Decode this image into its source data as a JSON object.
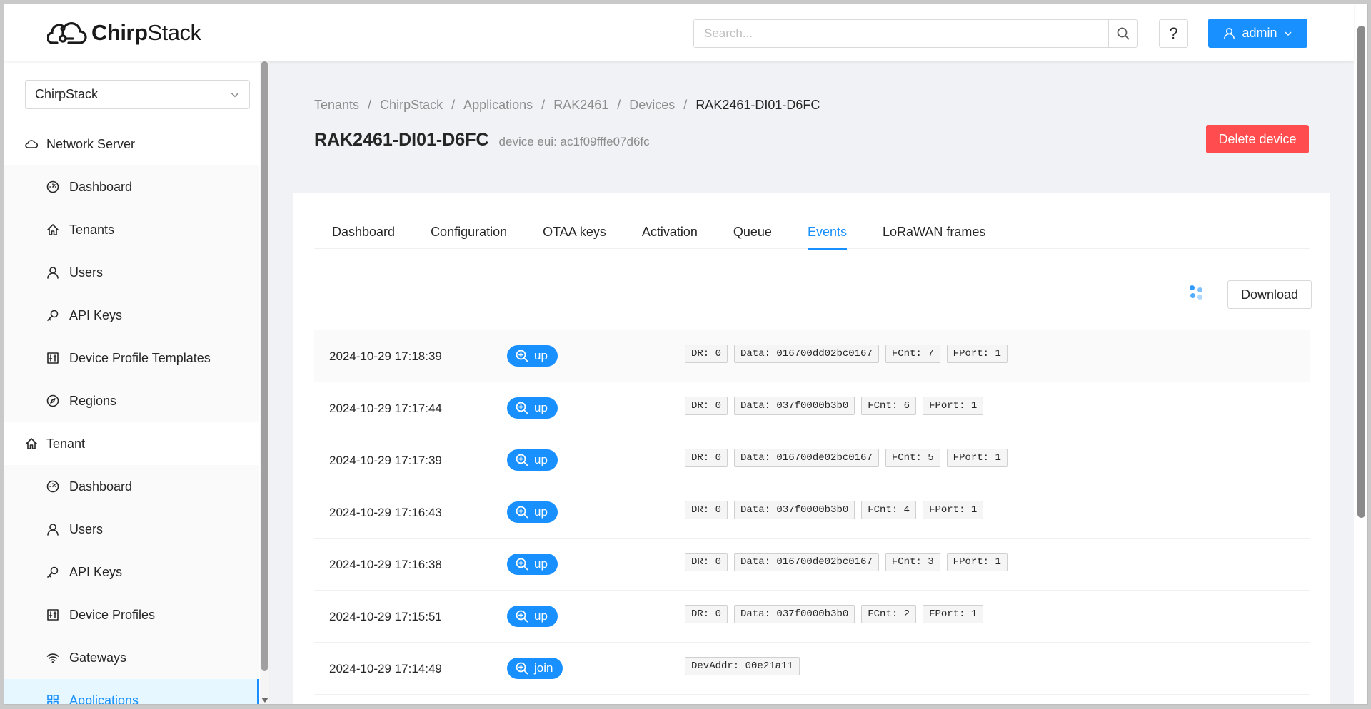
{
  "header": {
    "logo_text_bold": "Chirp",
    "logo_text_light": "Stack",
    "search_placeholder": "Search...",
    "help_label": "?",
    "user_label": "admin"
  },
  "sidebar": {
    "tenant_select": "ChirpStack",
    "network_server": {
      "label": "Network Server",
      "items": [
        {
          "label": "Dashboard",
          "icon": "dashboard-icon"
        },
        {
          "label": "Tenants",
          "icon": "home-icon"
        },
        {
          "label": "Users",
          "icon": "user-icon"
        },
        {
          "label": "API Keys",
          "icon": "key-icon"
        },
        {
          "label": "Device Profile Templates",
          "icon": "control-icon"
        },
        {
          "label": "Regions",
          "icon": "compass-icon"
        }
      ]
    },
    "tenant": {
      "label": "Tenant",
      "items": [
        {
          "label": "Dashboard",
          "icon": "dashboard-icon"
        },
        {
          "label": "Users",
          "icon": "user-icon"
        },
        {
          "label": "API Keys",
          "icon": "key-icon"
        },
        {
          "label": "Device Profiles",
          "icon": "control-icon"
        },
        {
          "label": "Gateways",
          "icon": "wifi-icon"
        },
        {
          "label": "Applications",
          "icon": "appstore-icon"
        }
      ]
    }
  },
  "breadcrumb": [
    "Tenants",
    "ChirpStack",
    "Applications",
    "RAK2461",
    "Devices",
    "RAK2461-DI01-D6FC"
  ],
  "page": {
    "title": "RAK2461-DI01-D6FC",
    "subtitle": "device eui: ac1f09fffe07d6fc",
    "delete_label": "Delete device"
  },
  "tabs": [
    "Dashboard",
    "Configuration",
    "OTAA keys",
    "Activation",
    "Queue",
    "Events",
    "LoRaWAN frames"
  ],
  "active_tab": "Events",
  "download_label": "Download",
  "colors": {
    "primary": "#1890ff",
    "danger": "#ff4d4f"
  },
  "events": [
    {
      "time": "2024-10-29 17:18:39",
      "type": "up",
      "codes": [
        "DR: 0",
        "Data: 016700dd02bc0167",
        "FCnt: 7",
        "FPort: 1"
      ]
    },
    {
      "time": "2024-10-29 17:17:44",
      "type": "up",
      "codes": [
        "DR: 0",
        "Data: 037f0000b3b0",
        "FCnt: 6",
        "FPort: 1"
      ]
    },
    {
      "time": "2024-10-29 17:17:39",
      "type": "up",
      "codes": [
        "DR: 0",
        "Data: 016700de02bc0167",
        "FCnt: 5",
        "FPort: 1"
      ]
    },
    {
      "time": "2024-10-29 17:16:43",
      "type": "up",
      "codes": [
        "DR: 0",
        "Data: 037f0000b3b0",
        "FCnt: 4",
        "FPort: 1"
      ]
    },
    {
      "time": "2024-10-29 17:16:38",
      "type": "up",
      "codes": [
        "DR: 0",
        "Data: 016700de02bc0167",
        "FCnt: 3",
        "FPort: 1"
      ]
    },
    {
      "time": "2024-10-29 17:15:51",
      "type": "up",
      "codes": [
        "DR: 0",
        "Data: 037f0000b3b0",
        "FCnt: 2",
        "FPort: 1"
      ]
    },
    {
      "time": "2024-10-29 17:14:49",
      "type": "join",
      "codes": [
        "DevAddr: 00e21a11"
      ]
    }
  ]
}
